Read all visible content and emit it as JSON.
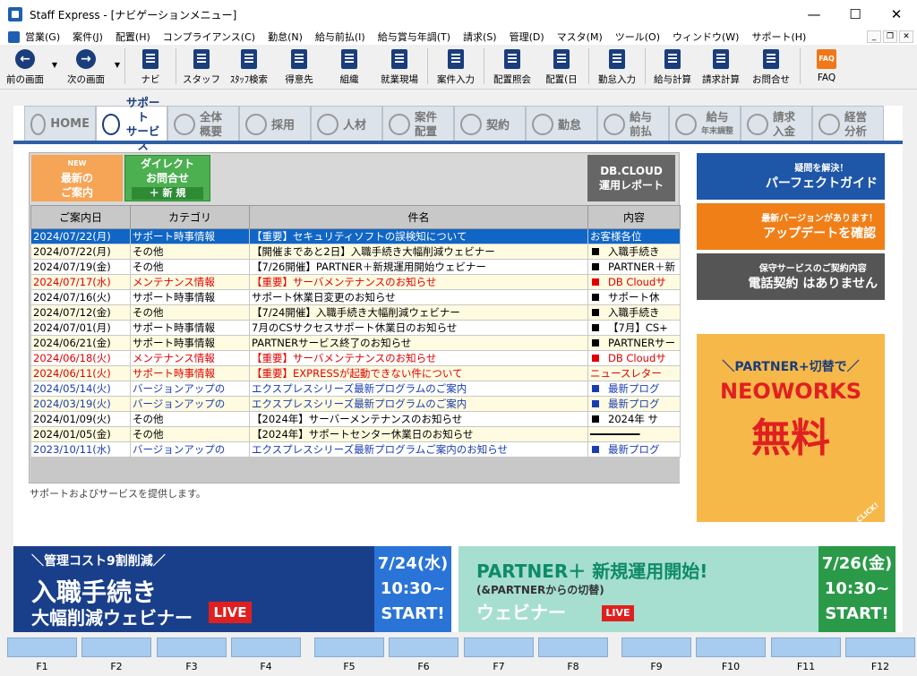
{
  "window": {
    "title": "Staff Express - [ナビゲーションメニュー]"
  },
  "menu": [
    "営業(G)",
    "案件(J)",
    "配置(H)",
    "コンプライアンス(C)",
    "勤怠(N)",
    "給与前払(I)",
    "給与賞与年調(T)",
    "請求(S)",
    "管理(D)",
    "マスタ(M)",
    "ツール(O)",
    "ウィンドウ(W)",
    "サポート(H)"
  ],
  "toolbar": {
    "back": "前の画面",
    "forward": "次の画面",
    "navi": "ナビ",
    "staff": "スタッフ",
    "staff_search": "ｽﾀｯﾌ検索",
    "client": "得意先",
    "org": "組織",
    "site": "就業現場",
    "case_input": "案件入力",
    "assign_inq": "配置照会",
    "assign_day": "配置(日",
    "attendance": "勤怠入力",
    "payroll": "給与計算",
    "billing": "請求計算",
    "inquiry": "お問合せ",
    "faq": "FAQ",
    "faq_icon": "FAQ"
  },
  "tabs": {
    "home": "HOME",
    "support_1": "サポート",
    "support_2": "サービス",
    "overview_1": "全体",
    "overview_2": "概要",
    "recruit": "採用",
    "hr": "人材",
    "case_1": "案件",
    "case_2": "配置",
    "contract": "契約",
    "attend": "勤怠",
    "pay_1": "給与",
    "pay_2": "前払",
    "sal_1": "給与",
    "sal_2": "年末調整",
    "bill_1": "請求",
    "bill_2": "入金",
    "mgmt_1": "経営",
    "mgmt_2": "分析"
  },
  "panel": {
    "new_badge": "NEW",
    "new_1": "最新の",
    "new_2": "ご案内",
    "direct_1": "ダイレクト",
    "direct_2": "お問合せ",
    "direct_new": "＋ 新 規",
    "db_1": "DB.CLOUD",
    "db_2": "運用レポート",
    "headers": [
      "ご案内日",
      "カテゴリ",
      "件名",
      "内容"
    ],
    "rows": [
      {
        "date": "2024/07/22(月)",
        "cat": "サポート時事情報",
        "subj": "【重要】セキュリティソフトの誤検知について",
        "body": "お客様各位",
        "cls": "sel",
        "sq": ""
      },
      {
        "date": "2024/07/22(月)",
        "cat": "その他",
        "subj": "【開催まであと2日】入職手続き大幅削減ウェビナー",
        "body": "入職手続き",
        "cls": "y",
        "sq": "#000"
      },
      {
        "date": "2024/07/19(金)",
        "cat": "その他",
        "subj": "【7/26開催】PARTNER＋新規運用開始ウェビナー",
        "body": "PARTNER＋新",
        "cls": "",
        "sq": "#000"
      },
      {
        "date": "2024/07/17(水)",
        "cat": "メンテナンス情報",
        "subj": "【重要】サーバメンテナンスのお知らせ",
        "body": "DB Cloudサ",
        "cls": "y c-red",
        "sq": "#e00000"
      },
      {
        "date": "2024/07/16(火)",
        "cat": "サポート時事情報",
        "subj": "サポート休業日変更のお知らせ",
        "body": "サポート休",
        "cls": "",
        "sq": "#000"
      },
      {
        "date": "2024/07/12(金)",
        "cat": "その他",
        "subj": "【7/24開催】入職手続き大幅削減ウェビナー",
        "body": "入職手続き",
        "cls": "y",
        "sq": "#000"
      },
      {
        "date": "2024/07/01(月)",
        "cat": "サポート時事情報",
        "subj": "7月のCSサクセスサポート休業日のお知らせ",
        "body": "【7月】CS+",
        "cls": "",
        "sq": "#000"
      },
      {
        "date": "2024/06/21(金)",
        "cat": "サポート時事情報",
        "subj": "PARTNERサービス終了のお知らせ",
        "body": "PARTNERサー",
        "cls": "y",
        "sq": "#000"
      },
      {
        "date": "2024/06/18(火)",
        "cat": "メンテナンス情報",
        "subj": "【重要】サーバメンテナンスのお知らせ",
        "body": "DB Cloudサ",
        "cls": "c-red",
        "sq": "#e00000"
      },
      {
        "date": "2024/06/11(火)",
        "cat": "サポート時事情報",
        "subj": "【重要】EXPRESSが起動できない件について",
        "body": "ニュースレター",
        "cls": "y c-red",
        "sq": ""
      },
      {
        "date": "2024/05/14(火)",
        "cat": "バージョンアップの",
        "subj": "エクスプレスシリーズ最新プログラムのご案内",
        "body": "最新プログ",
        "cls": "c-blue",
        "sq": "#1a3db0"
      },
      {
        "date": "2024/03/19(火)",
        "cat": "バージョンアップの",
        "subj": "エクスプレスシリーズ最新プログラムのご案内",
        "body": "最新プログ",
        "cls": "y c-blue",
        "sq": "#1a3db0"
      },
      {
        "date": "2024/01/09(火)",
        "cat": "その他",
        "subj": "【2024年】サーバーメンテナンスのお知らせ",
        "body": "2024年 サ",
        "cls": "",
        "sq": "#000"
      },
      {
        "date": "2024/01/05(金)",
        "cat": "その他",
        "subj": "【2024年】サポートセンター休業日のお知らせ",
        "body": "━━━━━━━━",
        "cls": "y",
        "sq": ""
      },
      {
        "date": "2023/10/11(水)",
        "cat": "バージョンアップの",
        "subj": "エクスプレスシリーズ最新プログラムご案内のお知らせ",
        "body": "最新プログ",
        "cls": "c-blue",
        "sq": "#1a3db0"
      }
    ],
    "footer": "サポートおよびサービスを提供します。"
  },
  "side": {
    "s1_1": "疑問を解決！",
    "s1_2": "パーフェクトガイド",
    "s2_1": "最新バージョンがあります！",
    "s2_2": "アップデートを確認",
    "s3_1": "保守サービスのご契約内容",
    "s3_2": "電話契約 はありません",
    "p_1": "＼PARTNER+切替で／",
    "p_2": "NEOWORKS",
    "p_3": "無料",
    "p_4": "CLICK!"
  },
  "banners": {
    "b1_1": "＼管理コスト9割削減／",
    "b1_2": "入職手続き",
    "b1_3": "大幅削減ウェビナー",
    "b1_live": "LIVE",
    "b1_d1": "7/24(水)",
    "b1_d2": "10:30~",
    "b1_d3": "START!",
    "b2_1": "PARTNER＋ 新規運用開始!",
    "b2_2": "(&PARTNERからの切替)",
    "b2_3": "ウェビナー",
    "b2_live": "LIVE",
    "b2_d1": "7/26(金)",
    "b2_d2": "10:30~",
    "b2_d3": "START!"
  },
  "fkeys": [
    "F1",
    "F2",
    "F3",
    "F4",
    "F5",
    "F6",
    "F7",
    "F8",
    "F9",
    "F10",
    "F11",
    "F12"
  ]
}
